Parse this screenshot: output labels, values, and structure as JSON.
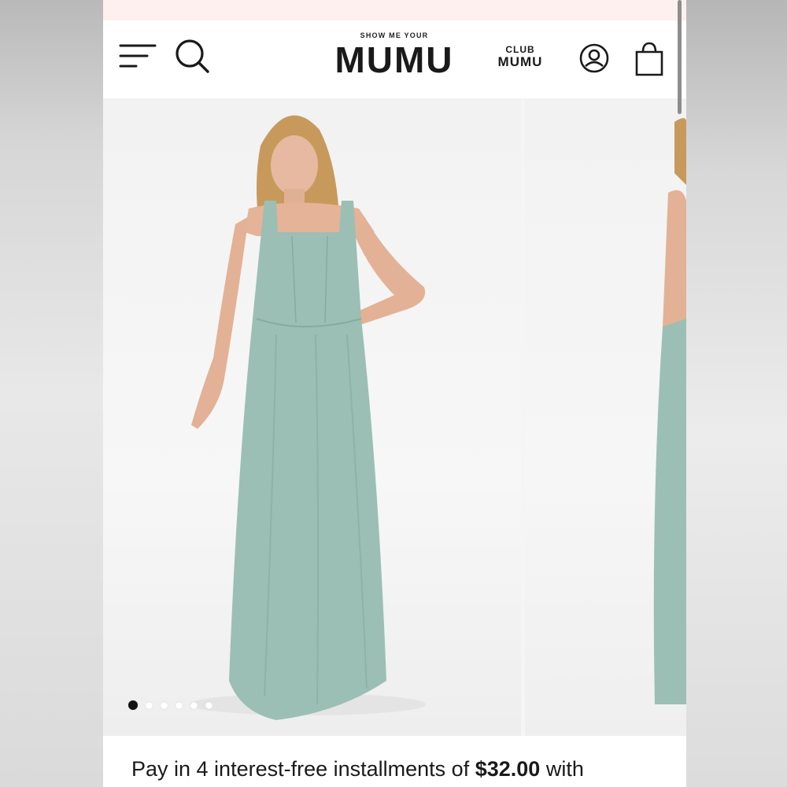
{
  "header": {
    "logo_small": "SHOW ME YOUR",
    "logo_big": "MUMU",
    "club_top": "CLUB",
    "club_bottom": "MUMU",
    "icons": [
      "menu-icon",
      "search-icon",
      "account-icon",
      "shopping-bag-icon"
    ]
  },
  "gallery": {
    "image_count": 6,
    "active_index": 0,
    "dress_color": "#9bbfb4"
  },
  "installment": {
    "prefix": "Pay in 4 interest-free installments of",
    "amount": "$32.00",
    "suffix": "with"
  },
  "colors": {
    "promo_strip": "#fdf0ee",
    "text": "#1a1a1a"
  }
}
